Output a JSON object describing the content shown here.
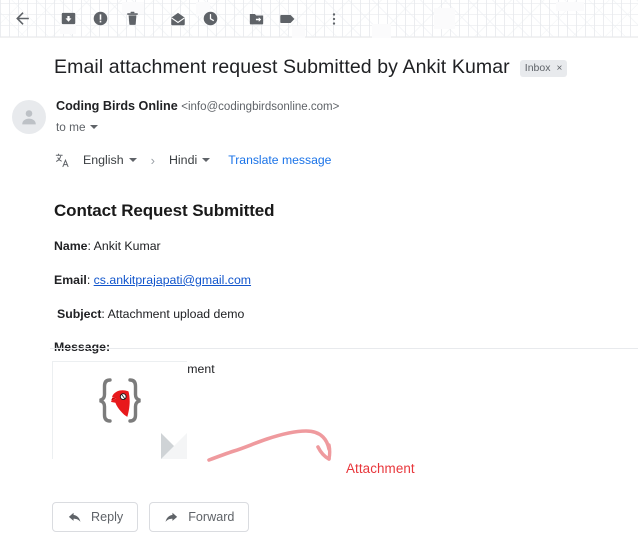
{
  "toolbar": {
    "items": [
      {
        "name": "back",
        "icon": "back-arrow-icon",
        "label": "Back"
      },
      {
        "name": "archive",
        "icon": "archive-icon",
        "label": "Archive"
      },
      {
        "name": "report-spam",
        "icon": "report-spam-icon",
        "label": "Report spam"
      },
      {
        "name": "delete",
        "icon": "trash-icon",
        "label": "Delete"
      },
      {
        "name": "mark-unread",
        "icon": "mark-unread-envelope-icon",
        "label": "Mark as unread"
      },
      {
        "name": "snooze",
        "icon": "clock-icon",
        "label": "Snooze"
      },
      {
        "name": "move-to",
        "icon": "move-to-folder-icon",
        "label": "Move to"
      },
      {
        "name": "labels",
        "icon": "label-tag-icon",
        "label": "Labels"
      },
      {
        "name": "more",
        "icon": "more-vertical-icon",
        "label": "More"
      }
    ]
  },
  "email": {
    "subject": "Email attachment request Submitted by Ankit Kumar",
    "label_chip": "Inbox",
    "label_chip_close": "×",
    "sender_name": "Coding Birds Online",
    "sender_address": "<info@codingbirdsonline.com>",
    "recipient": "to me"
  },
  "translate": {
    "icon": "translate-icon",
    "source_language": "English",
    "arrow": "›",
    "target_language": "Hindi",
    "action_link": "Translate message"
  },
  "body": {
    "title": "Contact Request Submitted",
    "name_label": "Name",
    "name_value": "Ankit Kumar",
    "email_label": "Email",
    "email_value": "cs.ankitprajapati@gmail.com",
    "subject_label": "Subject",
    "subject_value": "Attachment upload demo",
    "message_label": "Message:",
    "message_value": "hi, please find the attachment"
  },
  "attachment": {
    "thumbnail_icon": "coding-birds-logo-icon",
    "annotation_label": "Attachment",
    "annotation_color": "#e8363b"
  },
  "actions": {
    "reply_label": "Reply",
    "reply_icon": "reply-arrow-icon",
    "forward_label": "Forward",
    "forward_icon": "forward-arrow-icon"
  },
  "colors": {
    "link_blue": "#1a73e8",
    "email_link_blue": "#1155cc",
    "annotation_red": "#e8363b",
    "icon_gray": "#5f6368",
    "logo_red": "#e8191c"
  }
}
